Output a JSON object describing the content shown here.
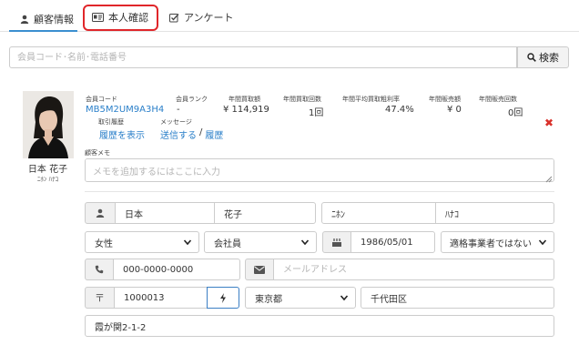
{
  "tabs": [
    {
      "label": "顧客情報"
    },
    {
      "label": "本人確認"
    },
    {
      "label": "アンケート"
    }
  ],
  "search": {
    "placeholder": "会員コード･名前･電話番号",
    "button_label": "検索"
  },
  "customer": {
    "name": "日本 花子",
    "kana": "ﾆﾎﾝ ﾊﾅｺ",
    "code_label": "会員コード",
    "code": "MB5M2UM9A3H4",
    "rank_label": "会員ランク",
    "rank": "-",
    "annual_purchase_label": "年間買取額",
    "annual_purchase": "¥ 114,919",
    "annual_purchase_count_label": "年間買取回数",
    "annual_purchase_count": "1回",
    "avg_margin_label": "年間平均買取粗利率",
    "avg_margin": "47.4%",
    "annual_sales_label": "年間販売額",
    "annual_sales": "¥ 0",
    "annual_sales_count_label": "年間販売回数",
    "annual_sales_count": "0回",
    "history_label": "取引履歴",
    "history_link": "履歴を表示",
    "message_label": "メッセージ",
    "message_send": "送信する",
    "message_sep": "/",
    "message_history": "履歴",
    "memo_label": "顧客メモ",
    "memo_placeholder": "メモを追加するにはここに入力"
  },
  "form": {
    "last_name": "日本",
    "first_name": "花子",
    "last_kana": "ﾆﾎﾝ",
    "first_kana": "ﾊﾅｺ",
    "gender": "女性",
    "occupation": "会社員",
    "birthday": "1986/05/01",
    "invoice": "適格事業者ではない",
    "phone": "000-0000-0000",
    "email_placeholder": "メールアドレス",
    "postal_mark": "〒",
    "postal": "1000013",
    "prefecture": "東京都",
    "city": "千代田区",
    "address": "霞が関2-1-2"
  }
}
